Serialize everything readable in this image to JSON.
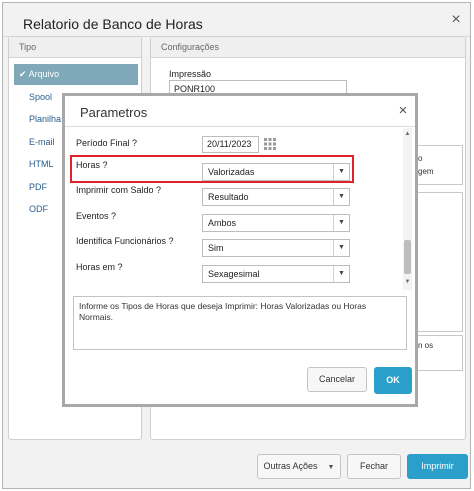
{
  "window": {
    "title": "Relatorio de Banco de Horas",
    "close_glyph": "×"
  },
  "tipo": {
    "header": "Tipo",
    "items": [
      {
        "label": "Arquivo",
        "selected": true,
        "check": "✔"
      },
      {
        "label": "Spool"
      },
      {
        "label": "Planilha"
      },
      {
        "label": "E-mail"
      },
      {
        "label": "HTML"
      },
      {
        "label": "PDF"
      },
      {
        "label": "ODF"
      }
    ]
  },
  "configuracoes": {
    "header": "Configurações",
    "impressao_label": "Impressão",
    "impressao_value": "PONR100",
    "fragments": [
      "o",
      "gem",
      "n os"
    ]
  },
  "footer": {
    "outras_acoes": "Outras Ações",
    "fechar": "Fechar",
    "imprimir": "Imprimir"
  },
  "modal": {
    "title": "Parametros",
    "close_glyph": "×",
    "fields": [
      {
        "label": "Período Final ?",
        "value": "20/11/2023"
      },
      {
        "label": "Horas ?",
        "value": "Valorizadas"
      },
      {
        "label": "Imprimir com Saldo ?",
        "value": "Resultado"
      },
      {
        "label": "Eventos ?",
        "value": "Ambos"
      },
      {
        "label": "Identifica Funcionários ?",
        "value": "Sim"
      },
      {
        "label": "Horas em ?",
        "value": "Sexagesimal"
      }
    ],
    "help_text": "Informe os Tipos de Horas que deseja Imprimir: Horas Valorizadas ou Horas Normais.",
    "cancel": "Cancelar",
    "ok": "OK"
  },
  "colors": {
    "accent": "#2a9fc9",
    "selected_tab": "#7fa8b8",
    "highlight": "#e0232b"
  }
}
